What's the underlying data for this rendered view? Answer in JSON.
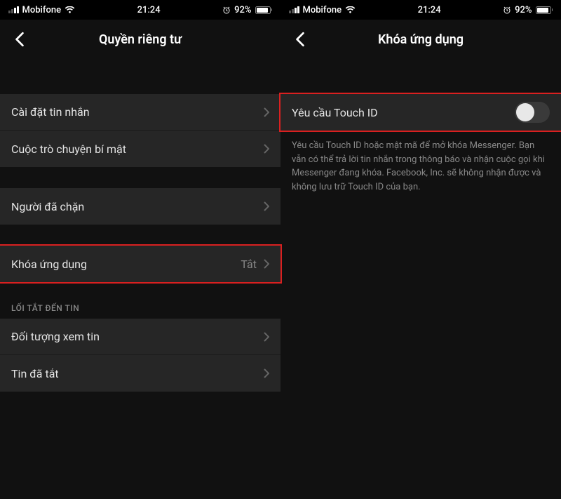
{
  "status": {
    "carrier": "Mobifone",
    "time": "21:24",
    "battery_pct": "92%"
  },
  "left_screen": {
    "title": "Quyền riêng tư",
    "group1": [
      {
        "label": "Cài đặt tin nhắn"
      },
      {
        "label": "Cuộc trò chuyện bí mật"
      }
    ],
    "group2": [
      {
        "label": "Người đã chặn"
      }
    ],
    "group3": [
      {
        "label": "Khóa ứng dụng",
        "value": "Tắt"
      }
    ],
    "section_header": "LỐI TẮT ĐẾN TIN",
    "group4": [
      {
        "label": "Đối tượng xem tin"
      },
      {
        "label": "Tin đã tắt"
      }
    ]
  },
  "right_screen": {
    "title": "Khóa ứng dụng",
    "toggle_row": {
      "label": "Yêu cầu Touch ID",
      "on": false
    },
    "description": "Yêu cầu Touch ID hoặc mật mã để mở khóa Messenger. Bạn vẫn có thể trả lời tin nhắn trong thông báo và nhận cuộc gọi khi Messenger đang khóa. Facebook, Inc. sẽ không nhận được và không lưu trữ Touch ID của bạn."
  }
}
